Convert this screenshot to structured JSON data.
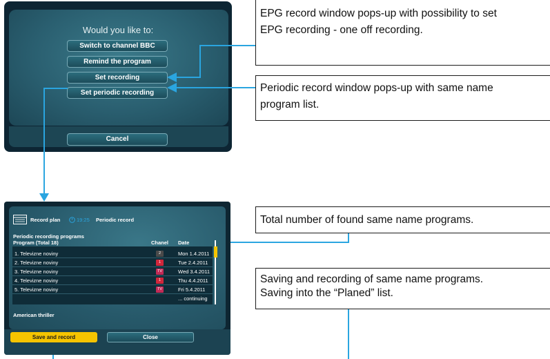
{
  "dialog": {
    "question": "Would you like to:",
    "buttons": [
      "Switch to channel BBC",
      "Remind the program",
      "Set recording",
      "Set periodic recording"
    ],
    "cancel": "Cancel"
  },
  "notes": {
    "epg_line1": "EPG record window pops-up with possibility to set",
    "epg_line2": "EPG recording - one off recording.",
    "periodic_line1": "Periodic record window pops-up with same name",
    "periodic_line2": "program list.",
    "total": "Total number of found same name programs.",
    "saving_line1": "Saving and recording of same name programs.",
    "saving_line2": "Saving into the “Planed” list."
  },
  "record_screen": {
    "header_title": "Record plan",
    "time": "19:25",
    "mode": "Periodic record",
    "section": "Periodic recording programs",
    "col_program": "Program  (Total 18)",
    "col_chanel": "Chanel",
    "col_date": "Date",
    "rows": [
      {
        "name": "1. Televizne noviny",
        "chanel": "2",
        "date": "Mon 1.4.2011",
        "color": "#4a4a4a"
      },
      {
        "name": "2. Televizne noviny",
        "chanel": "1",
        "date": "Tue 2.4.2011",
        "color": "#d0263b"
      },
      {
        "name": "3. Televizne noviny",
        "chanel": "TV",
        "date": "Wed 3.4.2011",
        "color": "#c22a56"
      },
      {
        "name": "4. Televizne noviny",
        "chanel": "1",
        "date": "Thu 4.4.2011",
        "color": "#d0263b"
      },
      {
        "name": "5. Televizne noviny",
        "chanel": "TV",
        "date": "Fri 5.4.2011",
        "color": "#c22a56"
      }
    ],
    "continuing": "... continuing",
    "description": "American thriller",
    "save_button": "Save and record",
    "close_button": "Close",
    "accent": "#f5c400"
  }
}
